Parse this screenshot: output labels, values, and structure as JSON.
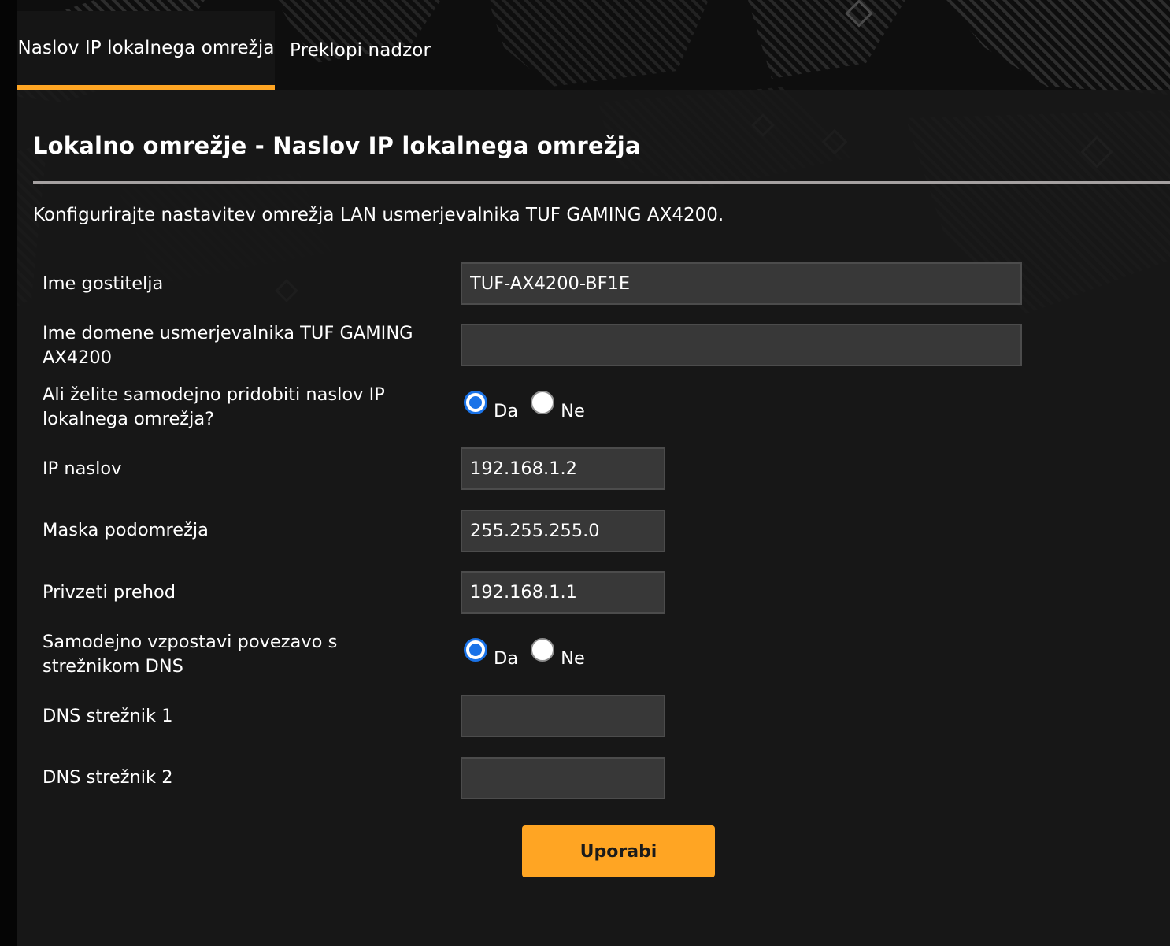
{
  "tabs": [
    {
      "label": "Naslov IP lokalnega omrežja",
      "active": true
    },
    {
      "label": "Preklopi nadzor",
      "active": false
    }
  ],
  "page": {
    "title": "Lokalno omrežje - Naslov IP lokalnega omrežja",
    "description": "Konfigurirajte nastavitev omrežja LAN usmerjevalnika TUF GAMING AX4200."
  },
  "form": {
    "hostname": {
      "label": "Ime gostitelja",
      "value": "TUF-AX4200-BF1E"
    },
    "domain_name": {
      "label": "Ime domene usmerjevalnika TUF GAMING AX4200",
      "value": ""
    },
    "auto_ip": {
      "label": "Ali želite samodejno pridobiti naslov IP lokalnega omrežja?",
      "yes": "Da",
      "no": "Ne",
      "selected": "Da"
    },
    "ip_address": {
      "label": "IP naslov",
      "value": "192.168.1.2"
    },
    "subnet_mask": {
      "label": "Maska podomrežja",
      "value": "255.255.255.0"
    },
    "gateway": {
      "label": "Privzeti prehod",
      "value": "192.168.1.1"
    },
    "auto_dns": {
      "label": "Samodejno vzpostavi povezavo s strežnikom DNS",
      "yes": "Da",
      "no": "Ne",
      "selected": "Da"
    },
    "dns1": {
      "label": "DNS strežnik 1",
      "value": ""
    },
    "dns2": {
      "label": "DNS strežnik 2",
      "value": ""
    }
  },
  "actions": {
    "apply_label": "Uporabi"
  },
  "colors": {
    "accent": "#ffa523",
    "radio_selected": "#1a73e8",
    "panel_bg": "#181818",
    "input_bg": "#383838"
  }
}
